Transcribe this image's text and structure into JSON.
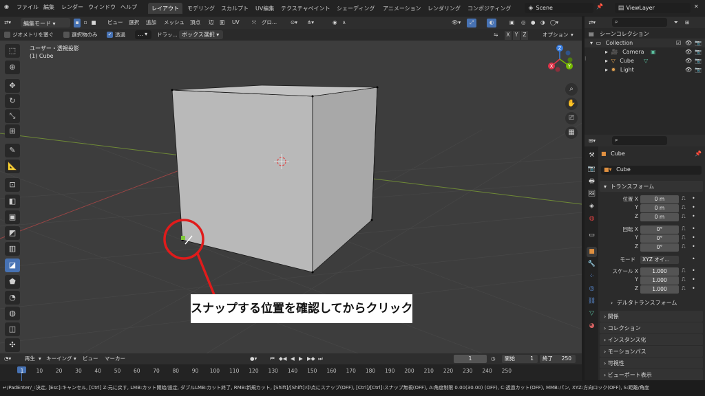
{
  "menu": {
    "items": [
      "ファイル",
      "編集",
      "レンダー",
      "ウィンドウ",
      "ヘルプ"
    ]
  },
  "workspace_tabs": [
    "レイアウト",
    "モデリング",
    "スカルプト",
    "UV編集",
    "テクスチャペイント",
    "シェーディング",
    "アニメーション",
    "レンダリング",
    "コンポジティング"
  ],
  "scene": {
    "name": "Scene",
    "viewlayer": "ViewLayer"
  },
  "viewport_header": {
    "mode": "編集モード",
    "menus": [
      "ビュー",
      "選択",
      "追加",
      "メッシュ",
      "頂点",
      "辺",
      "面",
      "UV"
    ],
    "transform": "グロ...",
    "xyz": [
      "X",
      "Y",
      "Z"
    ],
    "options": "オプション"
  },
  "tool_header": {
    "occlude": "ジオメトリを塞ぐ",
    "only_selected": "選択物のみ",
    "xray": "透過",
    "dots": "...",
    "drag": "ドラッ...",
    "box_select": "ボックス選択"
  },
  "viewport": {
    "view_name": "ユーザー・透視投影",
    "object_name": "(1) Cube",
    "annotation": "スナップする位置を確認してからクリック",
    "annotation_color": "#e01b1b"
  },
  "outliner": {
    "title": "シーンコレクション",
    "collection": "Collection",
    "objects": [
      "Camera",
      "Cube",
      "Light"
    ]
  },
  "properties": {
    "object_name": "Cube",
    "data_name": "Cube",
    "transform_title": "トランスフォーム",
    "location_label": "位置 X",
    "rotation_label": "回転 X",
    "scale_label": "スケール X",
    "y_label": "Y",
    "z_label": "Z",
    "location": [
      "0 m",
      "0 m",
      "0 m"
    ],
    "rotation": [
      "0°",
      "0°",
      "0°"
    ],
    "scale": [
      "1.000",
      "1.000",
      "1.000"
    ],
    "mode_label": "モード",
    "mode_value": "XYZ オイ...",
    "delta": "デルタトランスフォーム",
    "panels": [
      "関係",
      "コレクション",
      "インスタンス化",
      "モーションパス",
      "可視性",
      "ビューポート表示"
    ]
  },
  "timeline": {
    "playback": "再生",
    "keying": "キーイング",
    "view": "ビュー",
    "marker": "マーカー",
    "current_frame": "1",
    "start_label": "開始",
    "start": "1",
    "end_label": "終了",
    "end": "250",
    "ticks": [
      "1",
      "10",
      "20",
      "30",
      "40",
      "50",
      "60",
      "70",
      "80",
      "90",
      "100",
      "110",
      "120",
      "130",
      "140",
      "150",
      "160",
      "170",
      "180",
      "190",
      "200",
      "210",
      "220",
      "230",
      "240",
      "250"
    ]
  },
  "status_bar": "↵/PadEnter/_:決定, [Esc]:キャンセル, [Ctrl] Z:元に戻す, LMB:カット開始/設定, ダブルLMB:カット終了, RMB:新規カット, [Shift]/[Shift]:中点にスナップ(OFF), [Ctrl]/[Ctrl]:スナップ無視(OFF), A:角度制限 0.00(30.00) (OFF), C:透過カット(OFF), MMB:パン, XYZ:方向ロック(OFF), S:距離/角度",
  "colors": {
    "accent": "#4772b3",
    "viewport_bg": "#3d3d3d",
    "axis_x": "#b34a4a",
    "axis_y": "#7f9a3a",
    "gizmo_x": "#e0344a",
    "gizmo_y": "#76b800",
    "gizmo_z": "#3a7ee0",
    "cube_face": "#b8b8b8"
  }
}
